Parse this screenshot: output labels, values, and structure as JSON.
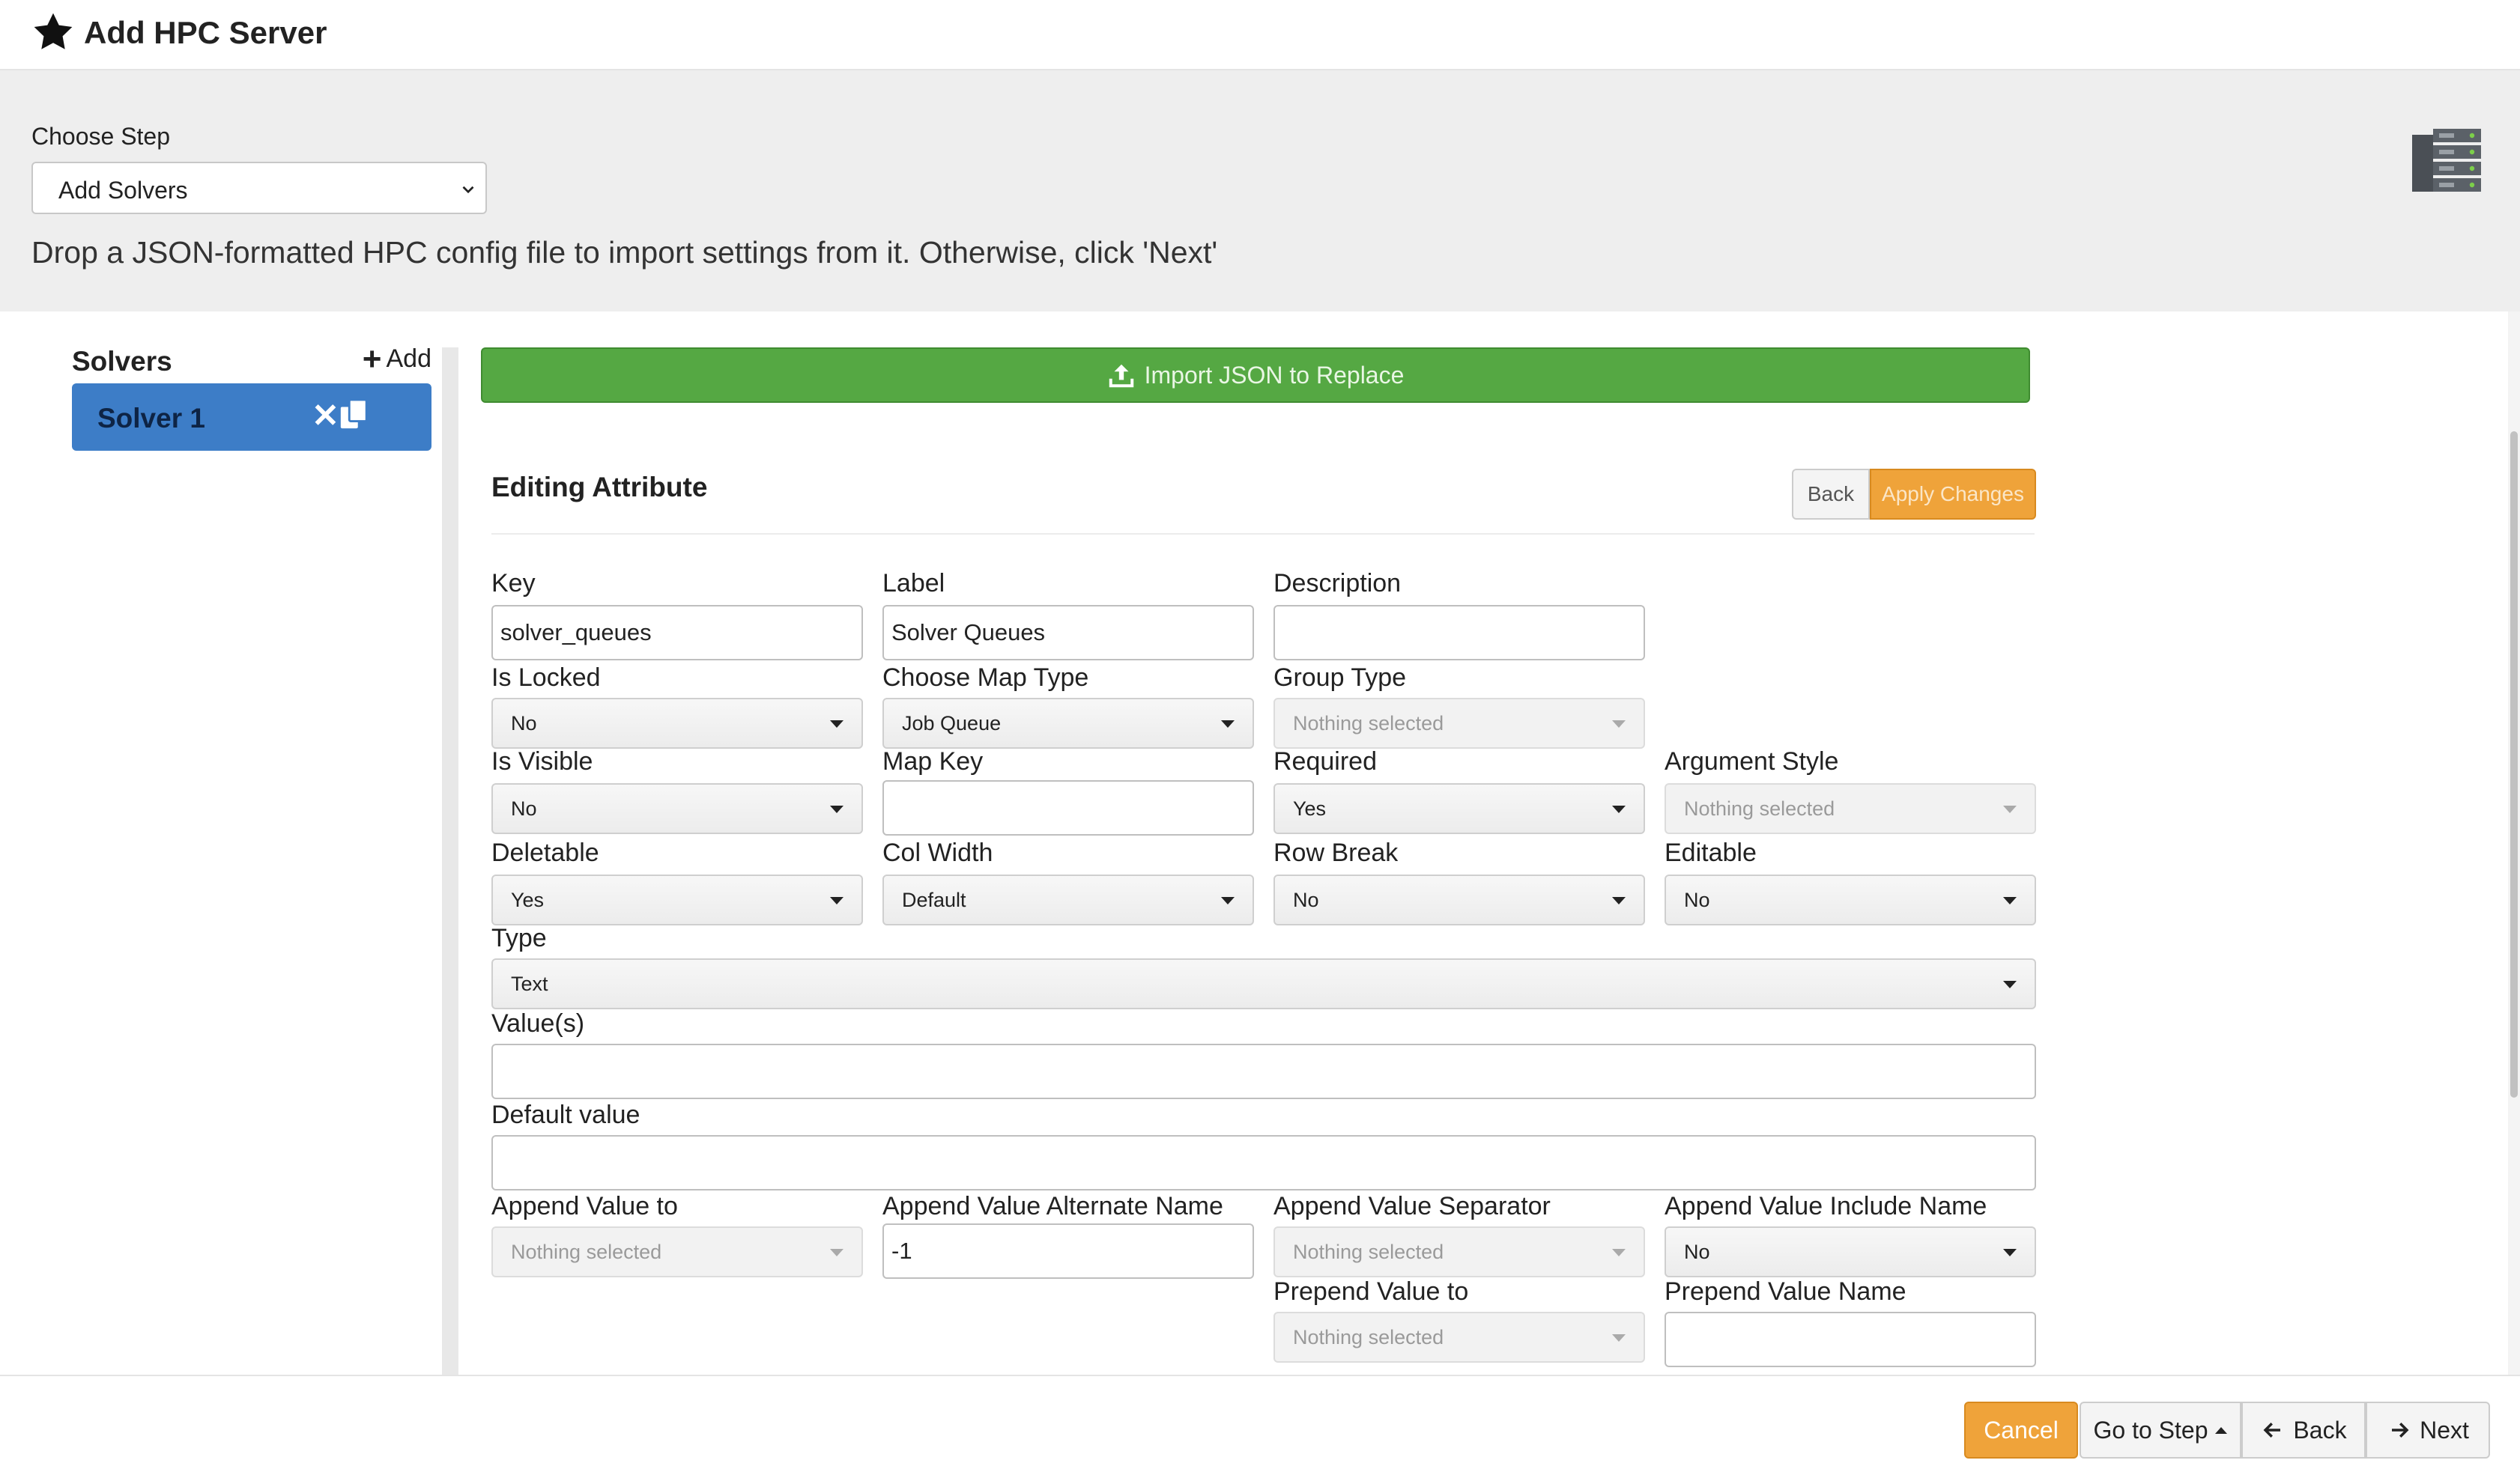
{
  "header": {
    "title": "Add HPC Server",
    "icon": "star-icon"
  },
  "step": {
    "label": "Choose Step",
    "selected": "Add Solvers",
    "hint": "Drop a JSON-formatted HPC config file to import settings from it. Otherwise, click 'Next'"
  },
  "sidebar": {
    "title": "Solvers",
    "add_label": "Add",
    "items": [
      {
        "label": "Solver 1"
      }
    ]
  },
  "main": {
    "import_label": "Import JSON to Replace",
    "editing_title": "Editing Attribute",
    "back_label": "Back",
    "apply_label": "Apply Changes"
  },
  "fields": {
    "key": {
      "label": "Key",
      "value": "solver_queues"
    },
    "label": {
      "label": "Label",
      "value": "Solver Queues"
    },
    "description": {
      "label": "Description",
      "value": ""
    },
    "is_locked": {
      "label": "Is Locked",
      "value": "No"
    },
    "map_type": {
      "label": "Choose Map Type",
      "value": "Job Queue"
    },
    "group_type": {
      "label": "Group Type",
      "value": "Nothing selected"
    },
    "is_visible": {
      "label": "Is Visible",
      "value": "No"
    },
    "map_key": {
      "label": "Map Key",
      "value": ""
    },
    "required": {
      "label": "Required",
      "value": "Yes"
    },
    "argument_style": {
      "label": "Argument Style",
      "value": "Nothing selected"
    },
    "deletable": {
      "label": "Deletable",
      "value": "Yes"
    },
    "col_width": {
      "label": "Col Width",
      "value": "Default"
    },
    "row_break": {
      "label": "Row Break",
      "value": "No"
    },
    "editable": {
      "label": "Editable",
      "value": "No"
    },
    "type": {
      "label": "Type",
      "value": "Text"
    },
    "values": {
      "label": "Value(s)",
      "value": ""
    },
    "default_value": {
      "label": "Default value",
      "value": ""
    },
    "append_value_to": {
      "label": "Append Value to",
      "value": "Nothing selected"
    },
    "append_alt_name": {
      "label": "Append Value Alternate Name",
      "value": "-1"
    },
    "append_separator": {
      "label": "Append Value Separator",
      "value": "Nothing selected"
    },
    "append_include_name": {
      "label": "Append Value Include Name",
      "value": "No"
    },
    "prepend_value_to": {
      "label": "Prepend Value to",
      "value": "Nothing selected"
    },
    "prepend_value_name": {
      "label": "Prepend Value Name",
      "value": ""
    }
  },
  "footer": {
    "cancel": "Cancel",
    "go_to_step": "Go to Step",
    "back": "Back",
    "next": "Next"
  },
  "colors": {
    "primary_blue": "#3d7dc7",
    "success_green": "#55a843",
    "warning_orange": "#efa33a"
  }
}
